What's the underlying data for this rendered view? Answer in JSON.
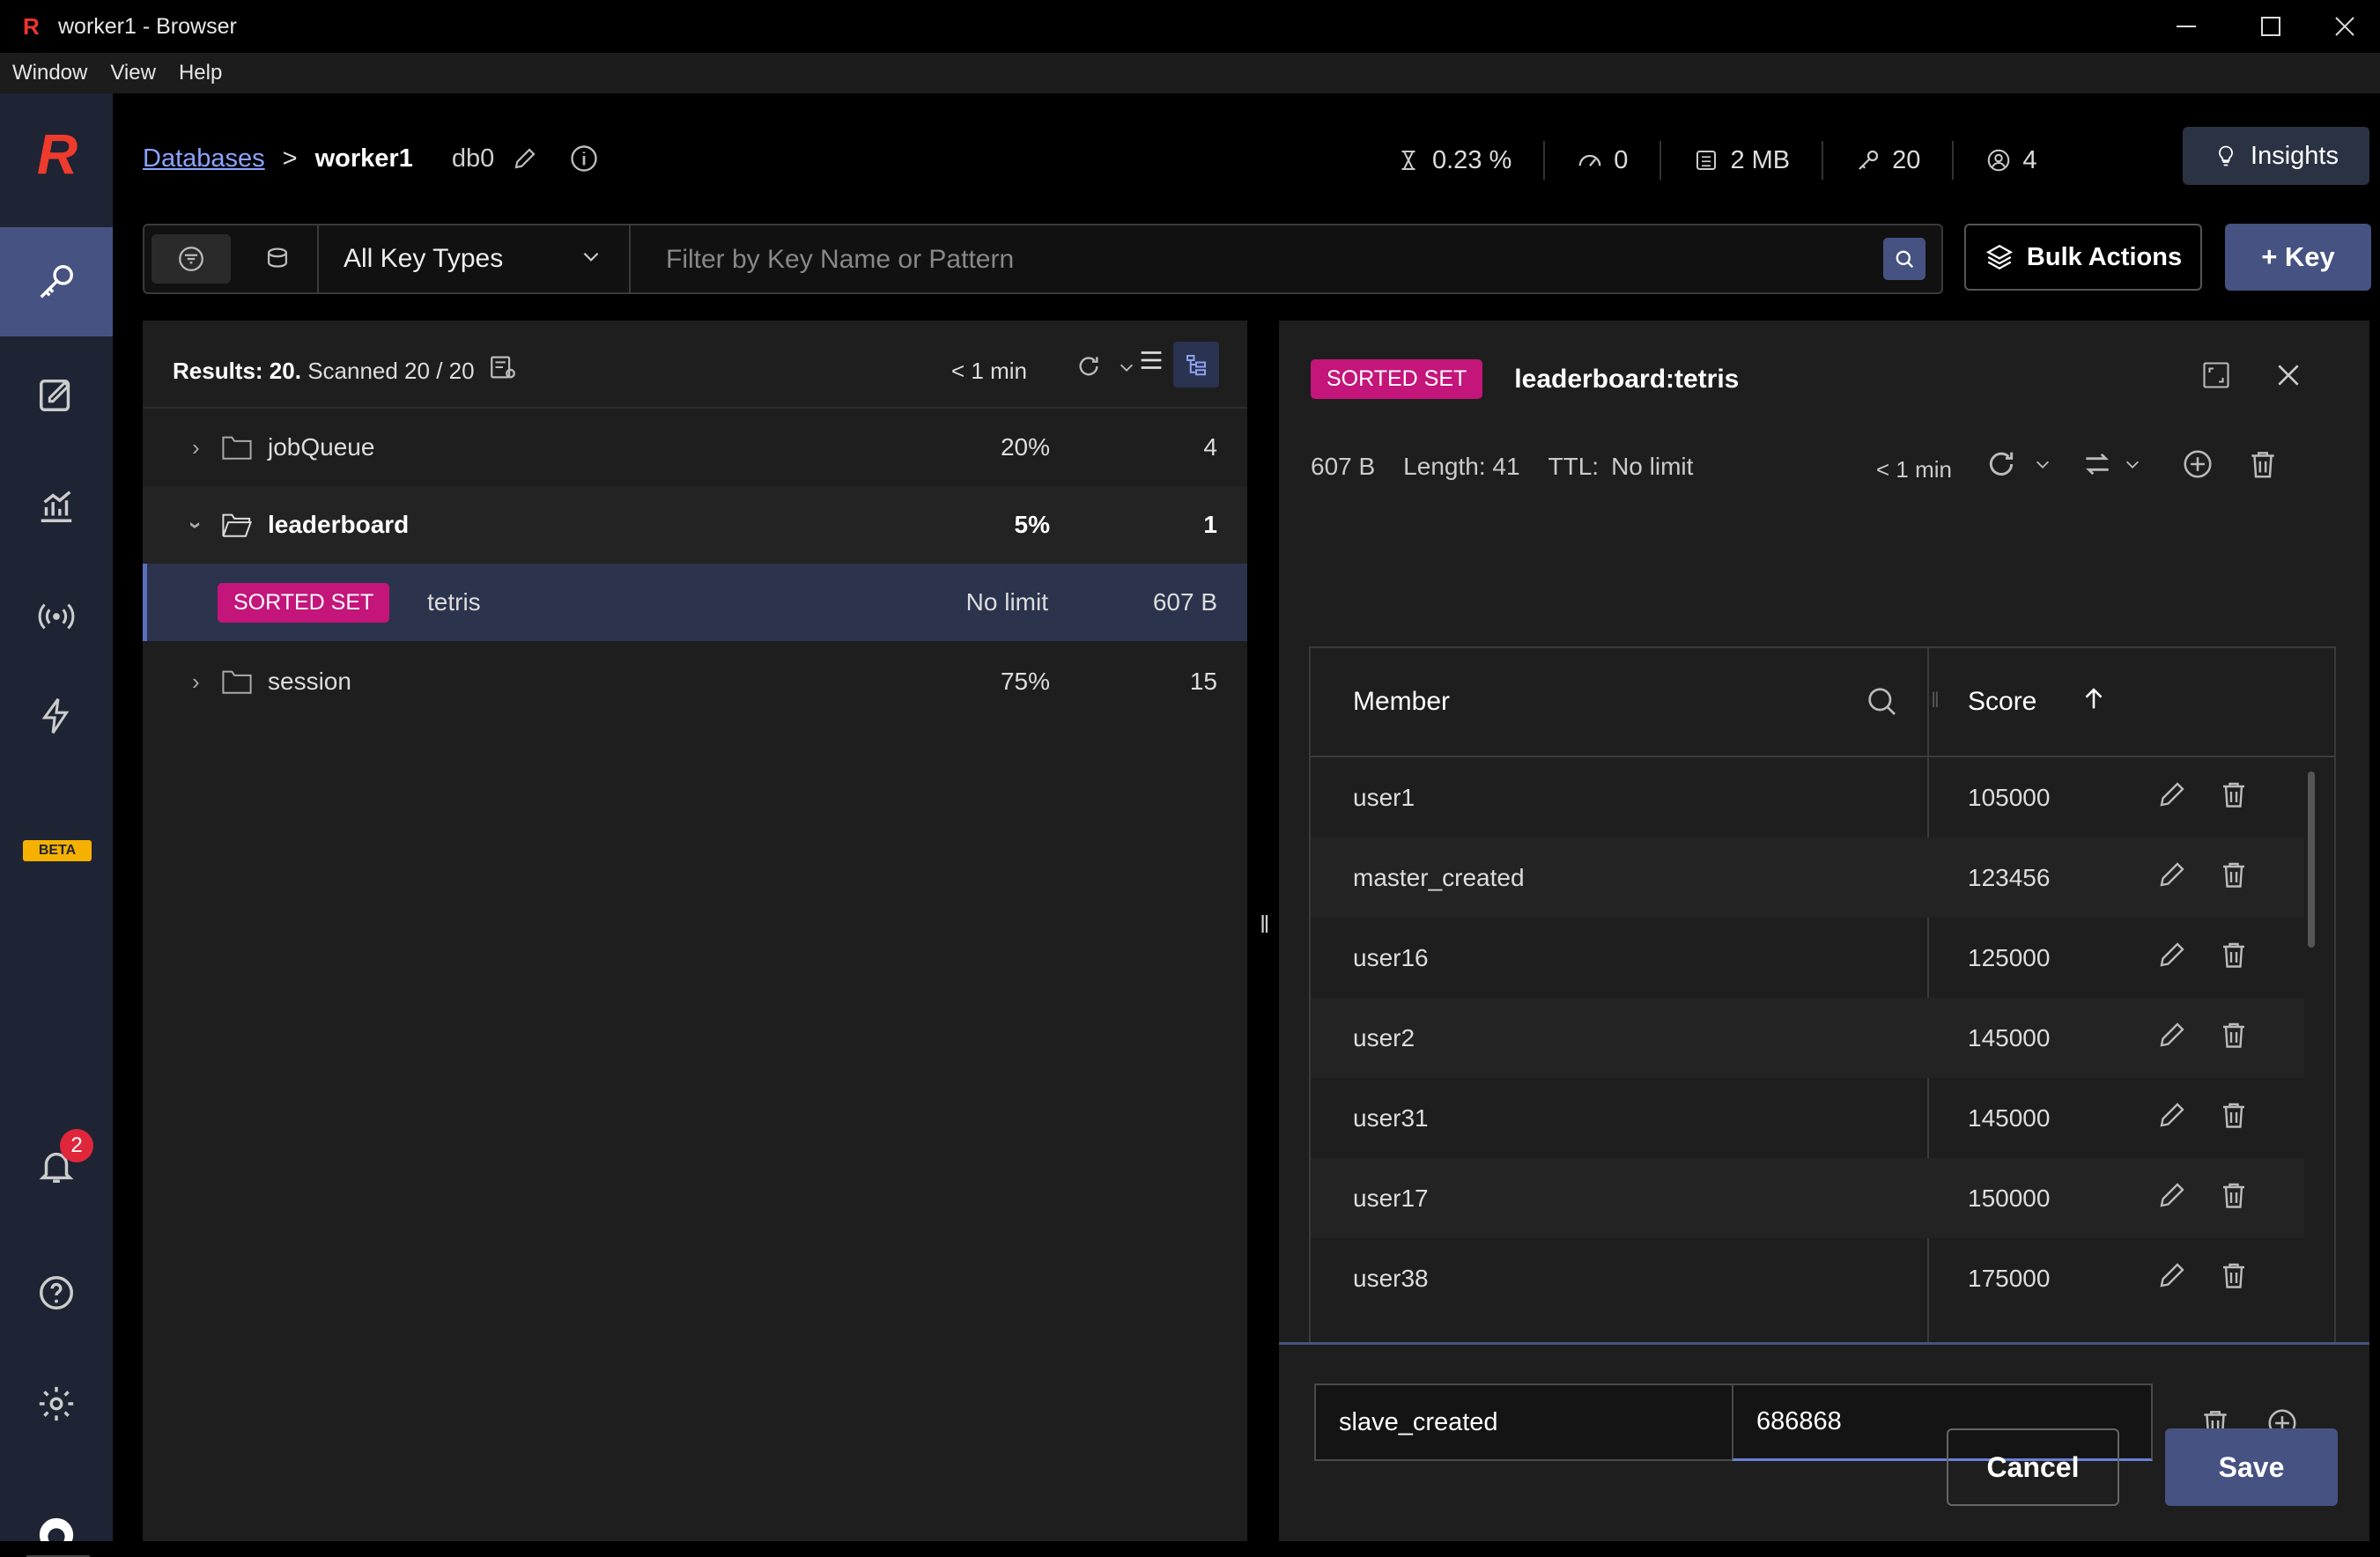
{
  "window": {
    "title": "worker1 - Browser"
  },
  "menu": [
    "Window",
    "View",
    "Help"
  ],
  "sidebar": {
    "beta_label": "BETA",
    "notifications_count": "2"
  },
  "header": {
    "breadcrumb_root": "Databases",
    "breadcrumb_sep": ">",
    "db_name": "worker1",
    "db_index": "db0",
    "stats": {
      "cpu": "0.23 %",
      "ops": "0",
      "memory": "2 MB",
      "keys": "20",
      "clients": "4"
    },
    "insights_label": "Insights"
  },
  "filter": {
    "key_type": "All Key Types",
    "placeholder": "Filter by Key Name or Pattern",
    "bulk_label": "Bulk Actions",
    "add_key_label": "+ Key"
  },
  "list": {
    "results_label": "Results: 20.",
    "scanned": "Scanned 20 / 20",
    "age": "< 1 min",
    "rows": [
      {
        "name": "jobQueue",
        "pct": "20%",
        "count": "4"
      },
      {
        "name": "leaderboard",
        "pct": "5%",
        "count": "1"
      },
      {
        "type": "SORTED SET",
        "name": "tetris",
        "ttl": "No limit",
        "size": "607 B"
      },
      {
        "name": "session",
        "pct": "75%",
        "count": "15"
      }
    ]
  },
  "detail": {
    "type": "SORTED SET",
    "key": "leaderboard:tetris",
    "size": "607 B",
    "length": "Length: 41",
    "ttl_label": "TTL:",
    "ttl_value": "No limit",
    "age": "< 1 min",
    "col_member": "Member",
    "col_score": "Score",
    "rows": [
      {
        "member": "user1",
        "score": "105000"
      },
      {
        "member": "master_created",
        "score": "123456"
      },
      {
        "member": "user16",
        "score": "125000"
      },
      {
        "member": "user2",
        "score": "145000"
      },
      {
        "member": "user31",
        "score": "145000"
      },
      {
        "member": "user17",
        "score": "150000"
      },
      {
        "member": "user38",
        "score": "175000"
      }
    ],
    "new_member": "slave_created",
    "new_score": "686868",
    "cancel_label": "Cancel",
    "save_label": "Save"
  }
}
